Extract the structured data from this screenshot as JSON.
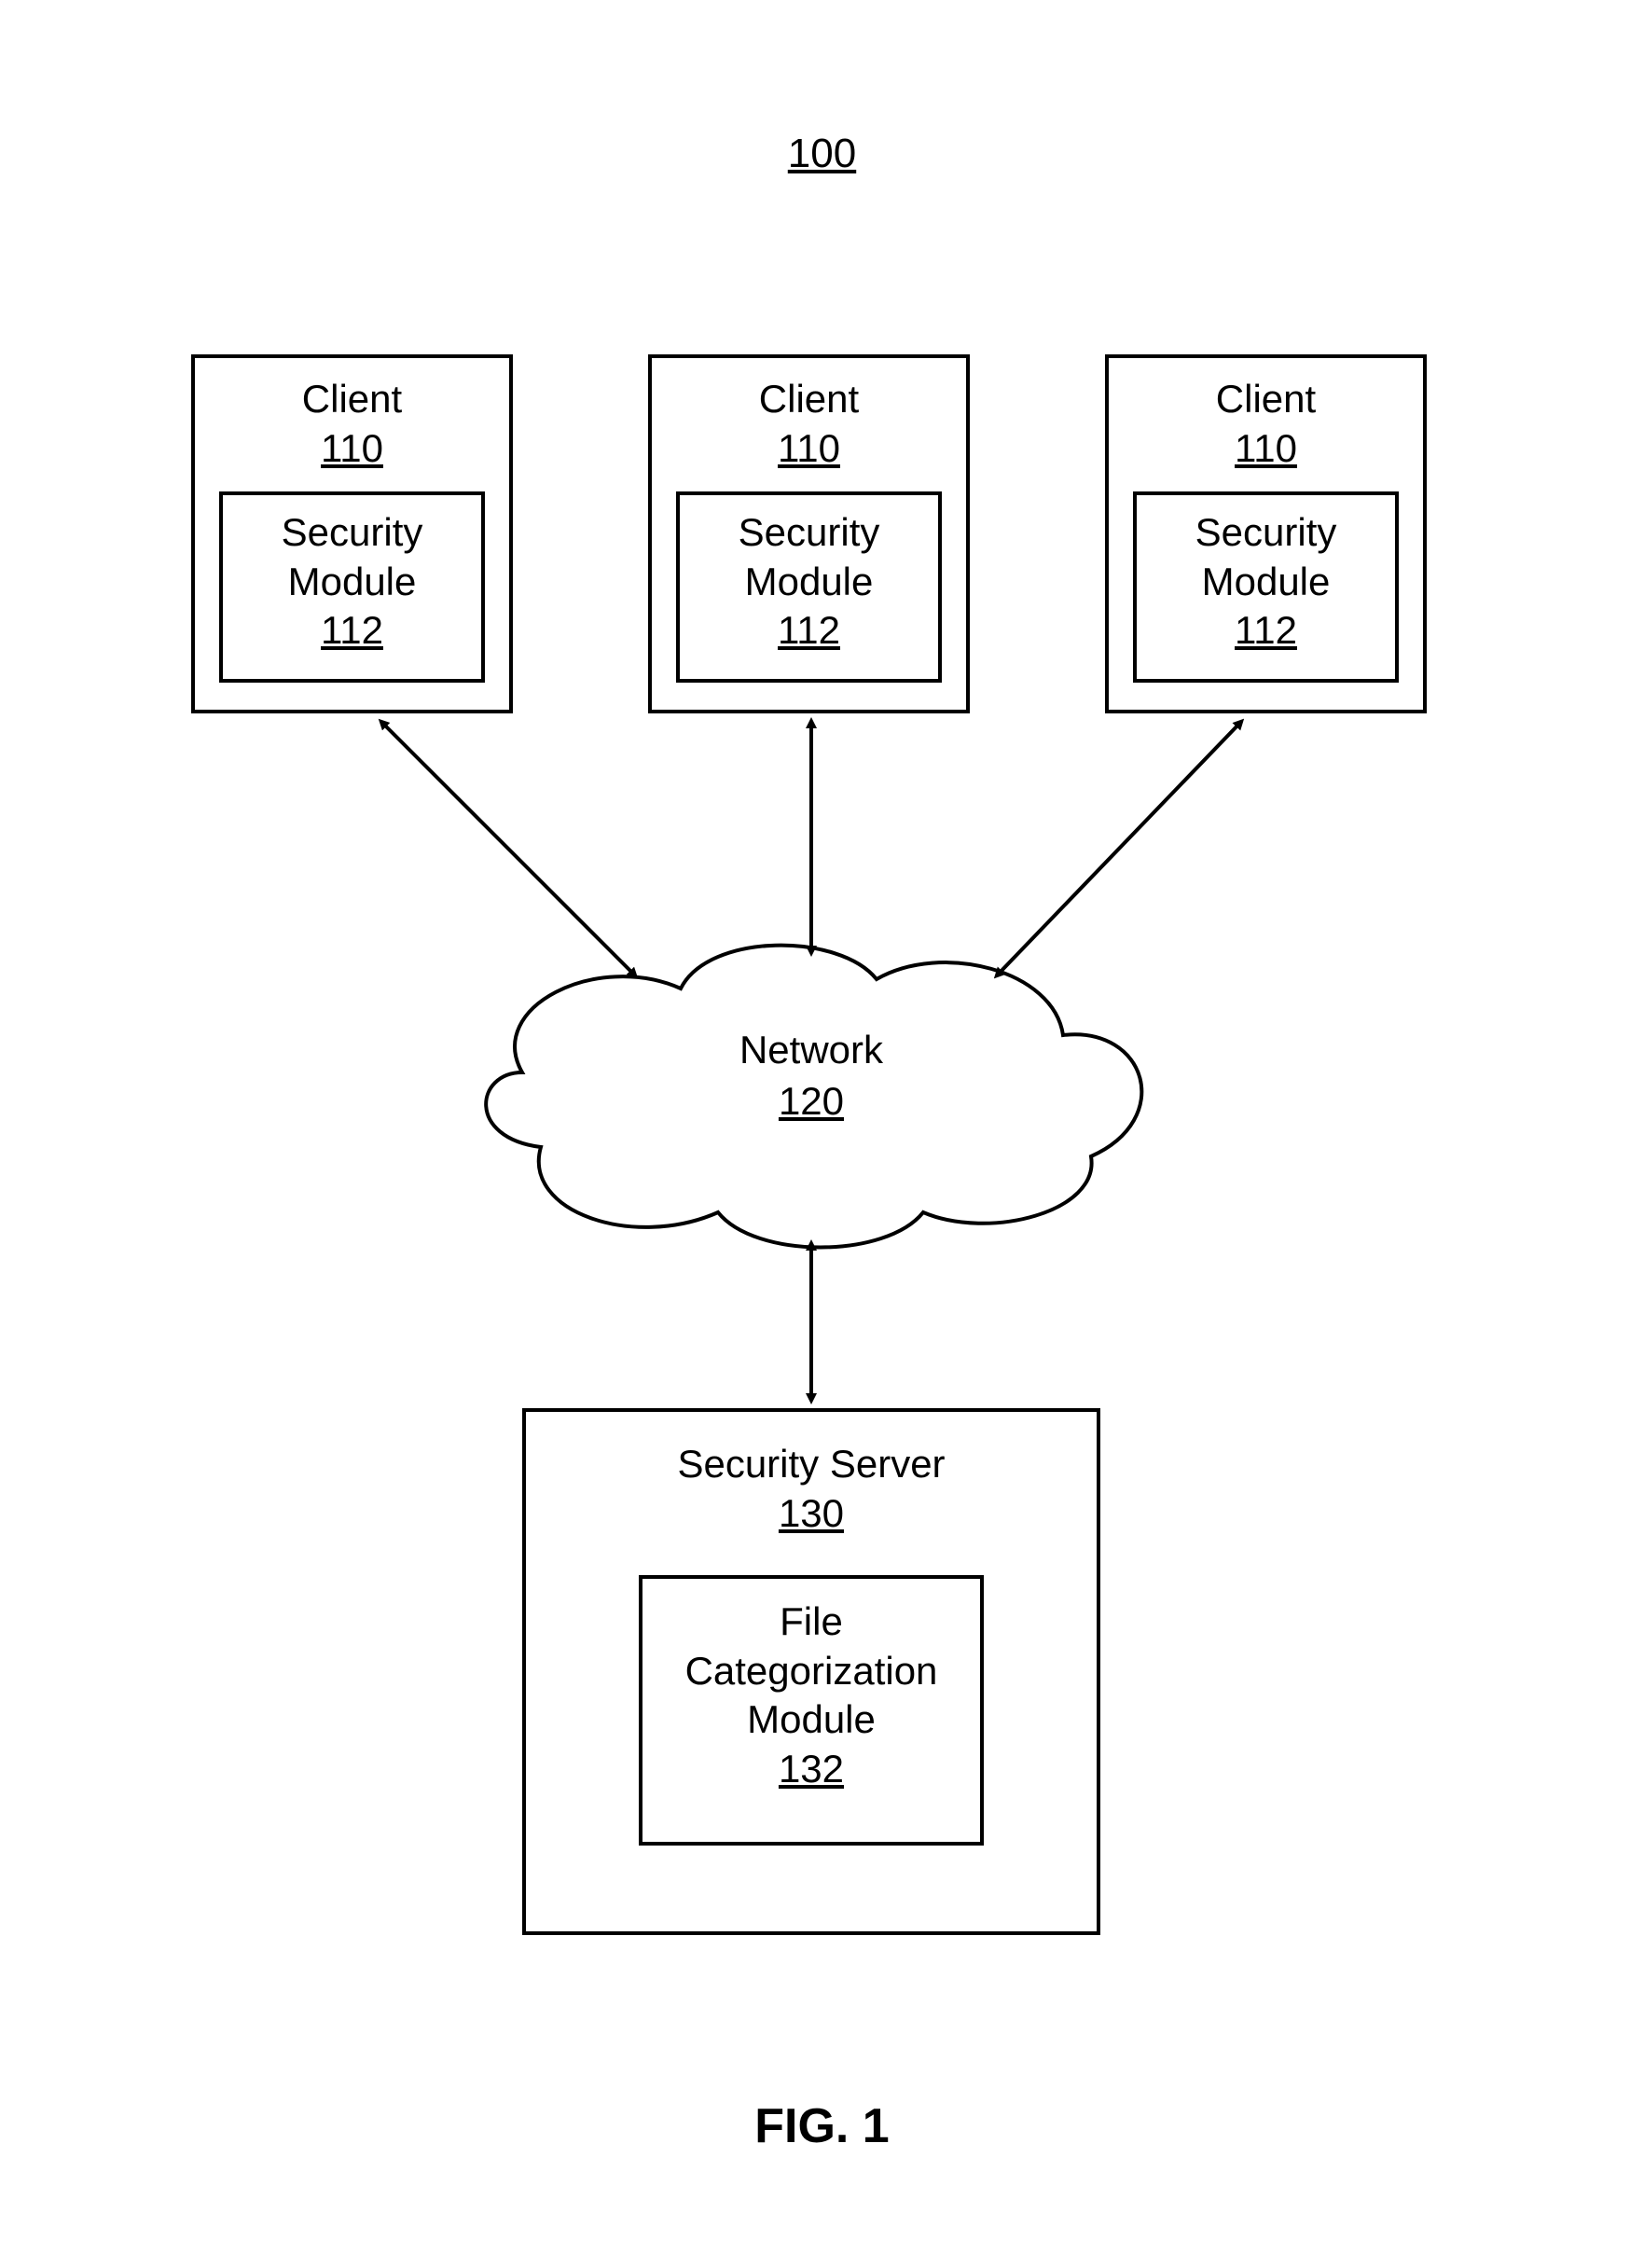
{
  "figure": {
    "title_number": "100",
    "caption": "FIG. 1"
  },
  "clients": [
    {
      "title": "Client",
      "ref": "110",
      "module_title": "Security",
      "module_word2": "Module",
      "module_ref": "112"
    },
    {
      "title": "Client",
      "ref": "110",
      "module_title": "Security",
      "module_word2": "Module",
      "module_ref": "112"
    },
    {
      "title": "Client",
      "ref": "110",
      "module_title": "Security",
      "module_word2": "Module",
      "module_ref": "112"
    }
  ],
  "network": {
    "title": "Network",
    "ref": "120"
  },
  "server": {
    "title": "Security Server",
    "ref": "130",
    "module_title_line1": "File",
    "module_title_line2": "Categorization",
    "module_title_line3": "Module",
    "module_ref": "132"
  }
}
